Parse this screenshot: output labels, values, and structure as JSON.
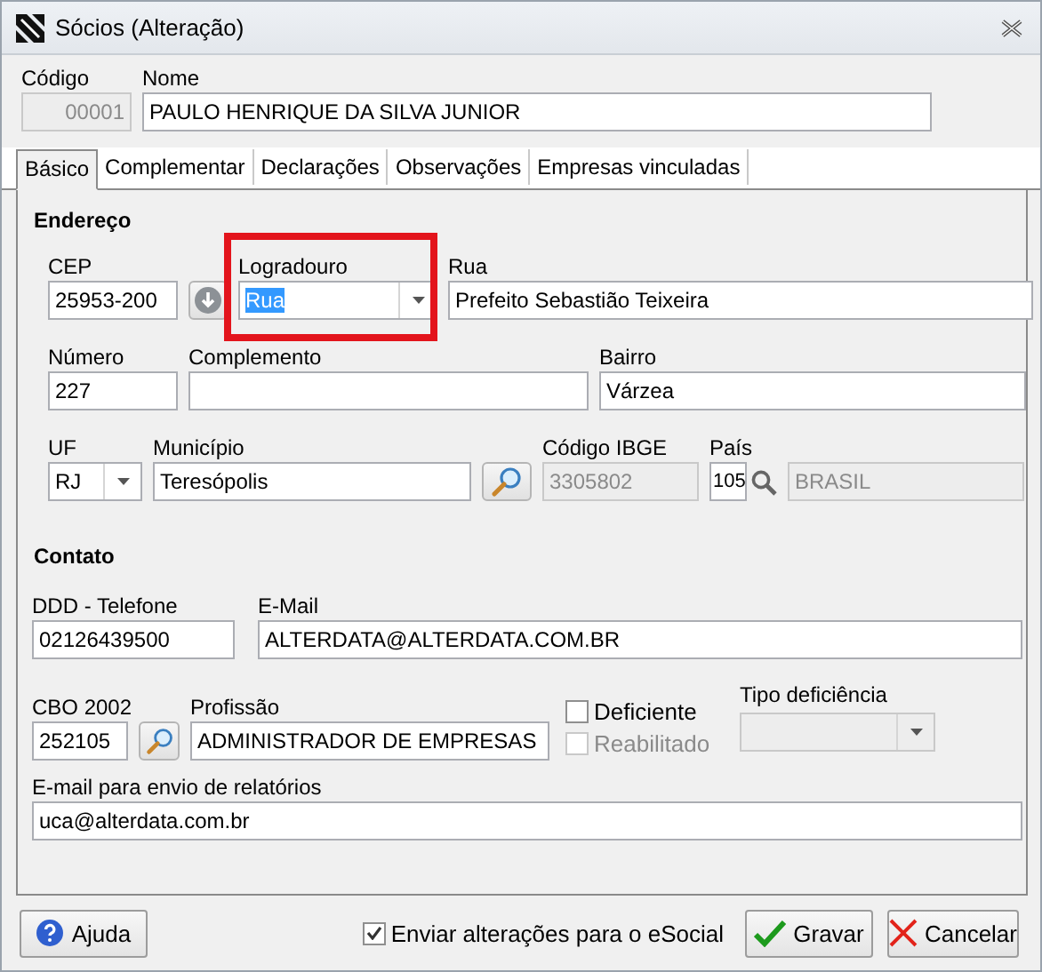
{
  "window": {
    "title": "Sócios (Alteração)"
  },
  "header": {
    "codigo": {
      "label": "Código",
      "value": "00001",
      "disabled": true
    },
    "nome": {
      "label": "Nome",
      "value": "PAULO HENRIQUE DA SILVA JUNIOR",
      "disabled": false
    }
  },
  "tabs": [
    {
      "label": "Básico",
      "selected": true
    },
    {
      "label": "Complementar",
      "selected": false
    },
    {
      "label": "Declarações",
      "selected": false
    },
    {
      "label": "Observações",
      "selected": false
    },
    {
      "label": "Empresas vinculadas",
      "selected": false
    }
  ],
  "endereco": {
    "title": "Endereço",
    "cep": {
      "label": "CEP",
      "value": "25953-200",
      "disabled": false
    },
    "logradouro": {
      "label": "Logradouro",
      "value": "Rua",
      "disabled": false,
      "text_selected": true,
      "highlighted": true
    },
    "rua": {
      "label": "Rua",
      "value": "Prefeito Sebastião Teixeira",
      "disabled": false
    },
    "numero": {
      "label": "Número",
      "value": "227",
      "disabled": false
    },
    "complemento": {
      "label": "Complemento",
      "disabled": false
    },
    "bairro": {
      "label": "Bairro",
      "value": "Várzea",
      "disabled": false
    },
    "uf": {
      "label": "UF",
      "value": "RJ",
      "disabled": false
    },
    "municipio": {
      "label": "Município",
      "value": "Teresópolis",
      "disabled": false
    },
    "codigo_ibge": {
      "label": "Código IBGE",
      "value": "3305802",
      "disabled": true
    },
    "pais": {
      "label": "País",
      "value": "105",
      "disabled": false
    },
    "pais_nome": {
      "value": "BRASIL",
      "disabled": true
    }
  },
  "contato": {
    "title": "Contato",
    "telefone": {
      "label": "DDD - Telefone",
      "value": "02126439500",
      "disabled": false
    },
    "email": {
      "label": "E-Mail",
      "value": "ALTERDATA@ALTERDATA.COM.BR",
      "disabled": false
    },
    "cbo": {
      "label": "CBO 2002",
      "value": "252105",
      "disabled": false
    },
    "profissao": {
      "label": "Profissão",
      "value": "ADMINISTRADOR DE EMPRESAS",
      "disabled": false
    },
    "deficiente": {
      "label": "Deficiente",
      "checked": false,
      "disabled": false
    },
    "reabilitado": {
      "label": "Reabilitado",
      "checked": false,
      "disabled": true
    },
    "tipo_deficiencia": {
      "label": "Tipo deficiência",
      "disabled": true
    },
    "email_relatorios": {
      "label": "E-mail para envio de relatórios",
      "value": "uca@alterdata.com.br",
      "disabled": false
    }
  },
  "footer": {
    "ajuda": "Ajuda",
    "enviar_esocial": {
      "label": "Enviar alterações para o eSocial",
      "checked": true,
      "disabled": false
    },
    "gravar": "Gravar",
    "cancelar": "Cancelar"
  }
}
